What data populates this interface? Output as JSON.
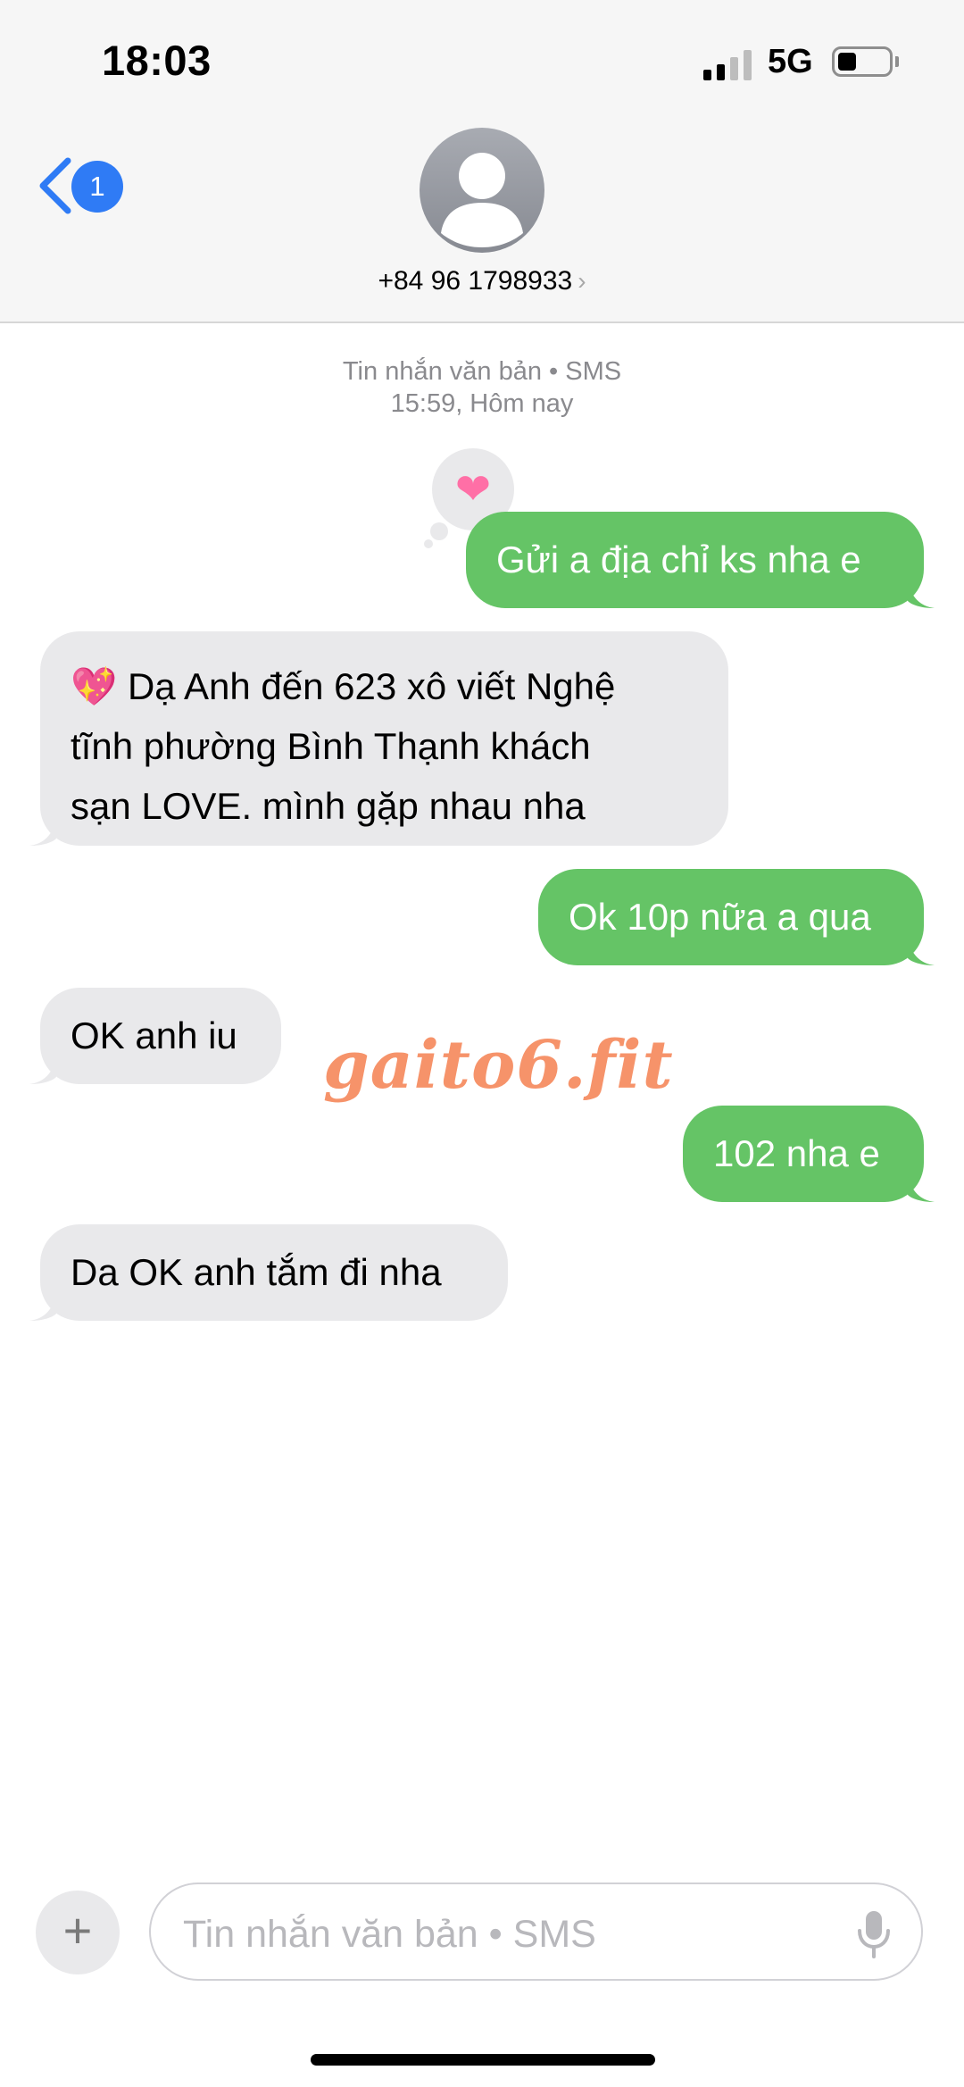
{
  "status_bar": {
    "time": "18:03",
    "network": "5G"
  },
  "header": {
    "back_badge": "1",
    "contact": "+84 96 1798933",
    "chevron": "›"
  },
  "meta": {
    "service": "Tin nhắn văn bản • SMS",
    "timestamp": "15:59, Hôm nay"
  },
  "tapback": {
    "emoji": "❤"
  },
  "messages": [
    {
      "dir": "out",
      "text": "Gửi a địa chỉ ks nha e"
    },
    {
      "dir": "in",
      "lines": [
        "💖 Dạ Anh đến 623 xô viết Nghệ",
        "tĩnh phường Bình Thạnh khách",
        "sạn LOVE. mình gặp nhau nha"
      ]
    },
    {
      "dir": "out",
      "text": "Ok 10p nữa a qua"
    },
    {
      "dir": "in",
      "text": "OK anh iu"
    },
    {
      "dir": "out",
      "text": "102 nha e"
    },
    {
      "dir": "in",
      "text": "Da OK anh tắm đi nha"
    }
  ],
  "watermark": "gaito6.fit",
  "composer": {
    "placeholder": "Tin nhắn văn bản • SMS",
    "plus": "+"
  },
  "colors": {
    "outgoing": "#65c466",
    "incoming": "#e9e9eb",
    "accent": "#2f7bf5",
    "watermark": "#f6936a"
  },
  "icons": [
    "back-chevron-icon",
    "contact-avatar-icon",
    "signal-icon",
    "battery-icon",
    "plus-icon",
    "microphone-icon"
  ]
}
